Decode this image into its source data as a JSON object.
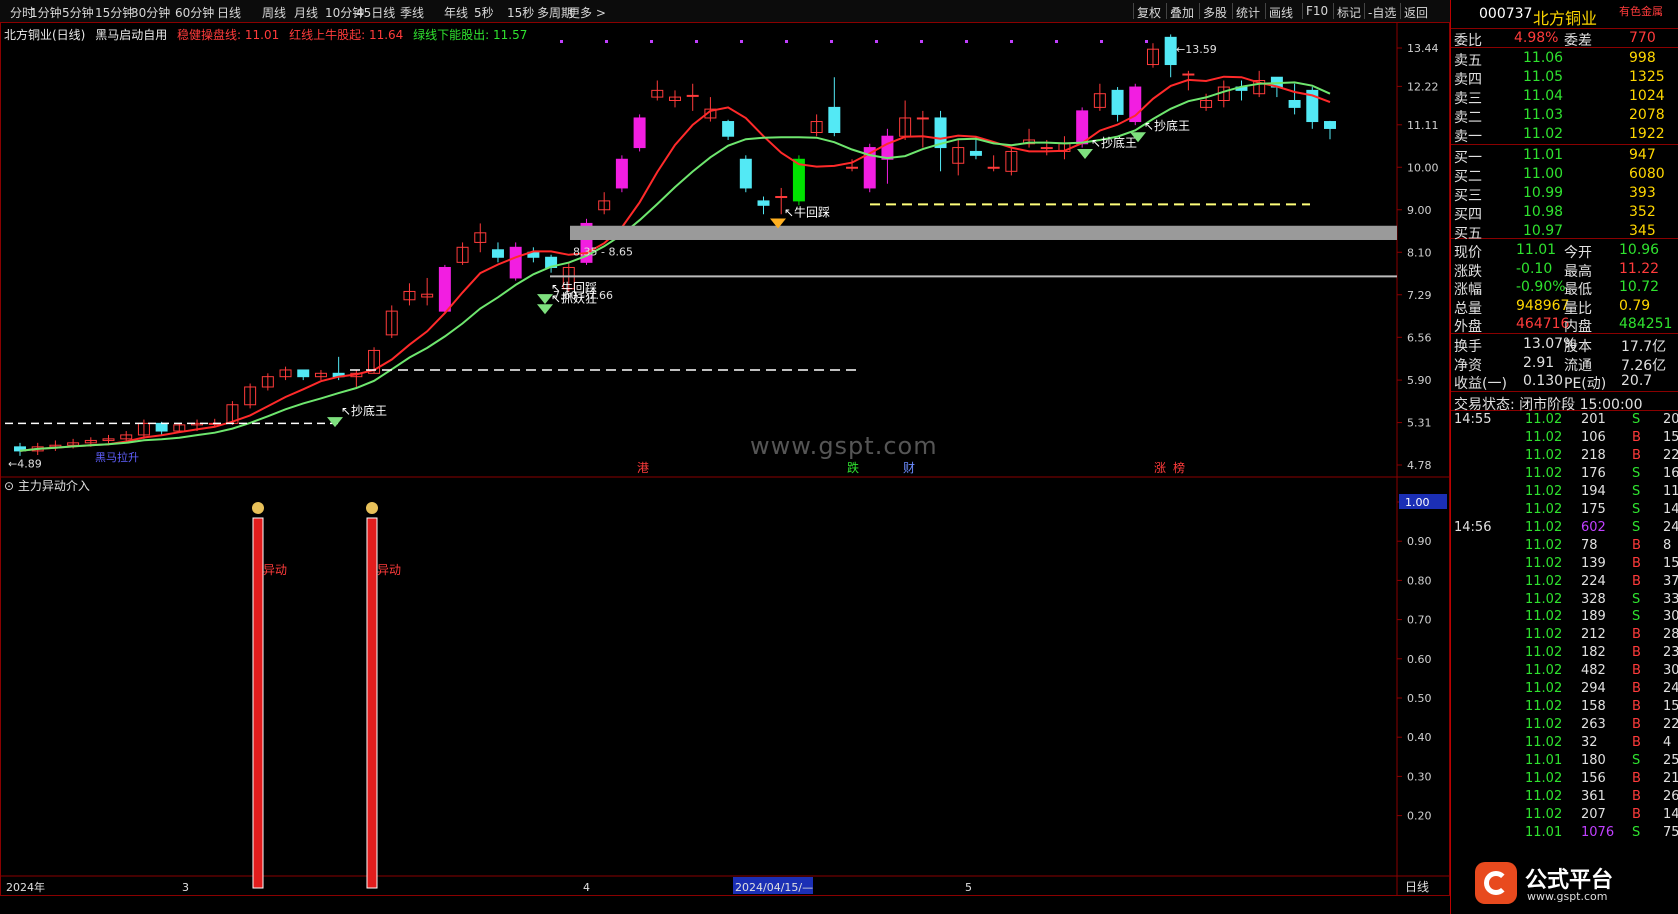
{
  "toolbar": {
    "periods": [
      "分时",
      "1分钟",
      "5分钟",
      "15分钟",
      "30分钟",
      "60分钟",
      "日线",
      "周线",
      "月线",
      "10分钟",
      "45日线",
      "季线",
      "年线",
      "5秒",
      "15秒",
      "多周期",
      "更多 >"
    ],
    "right_tools": [
      "复权",
      "叠加",
      "多股",
      "统计",
      "画线",
      "F10",
      "标记",
      "-自选",
      "返回"
    ]
  },
  "chart_header": {
    "stock_period": "北方铜业(日线)",
    "indicator_name": "黑马启动自用",
    "line1": "稳健操盘线: 11.01",
    "line2": "红线上牛股起: 11.64",
    "line3": "绿线下能股出: 11.57"
  },
  "price_axis": [
    "13.44",
    "12.22",
    "11.11",
    "10.00",
    "9.00",
    "8.10",
    "7.29",
    "6.56",
    "5.90",
    "5.31",
    "4.78"
  ],
  "chart_annotations": {
    "high_label": "13.59",
    "low_label": "4.89",
    "zone1": "8.35 - 8.65",
    "zone2": "7.60 - 7.66",
    "signals": [
      "抄底王",
      "牛回踩",
      "抄底王",
      "抄底王",
      "牛回踩",
      "抓妖狂"
    ],
    "bottom_label": "黑马拉升"
  },
  "watermark": "www.gspt.com",
  "event_markers": [
    "港",
    "跌",
    "财",
    "涨",
    "榜"
  ],
  "sub_chart": {
    "title": "主力异动介入",
    "axis": [
      "1.00",
      "0.90",
      "0.80",
      "0.70",
      "0.60",
      "0.50",
      "0.40",
      "0.30",
      "0.20"
    ],
    "bar_label": "异动"
  },
  "date_axis": [
    "2024年",
    "3",
    "4",
    "2024/04/15/—",
    "5"
  ],
  "period_label": "日线",
  "quote": {
    "code": "000737",
    "name": "北方铜业",
    "sector": "有色金属",
    "weibi_label": "委比",
    "weibi": "4.98%",
    "weicha_label": "委差",
    "weicha": "770",
    "sells": [
      {
        "label": "卖五",
        "price": "11.06",
        "vol": "998"
      },
      {
        "label": "卖四",
        "price": "11.05",
        "vol": "1325"
      },
      {
        "label": "卖三",
        "price": "11.04",
        "vol": "1024"
      },
      {
        "label": "卖二",
        "price": "11.03",
        "vol": "2078"
      },
      {
        "label": "卖一",
        "price": "11.02",
        "vol": "1922"
      }
    ],
    "buys": [
      {
        "label": "买一",
        "price": "11.01",
        "vol": "947"
      },
      {
        "label": "买二",
        "price": "11.00",
        "vol": "6080"
      },
      {
        "label": "买三",
        "price": "10.99",
        "vol": "393"
      },
      {
        "label": "买四",
        "price": "10.98",
        "vol": "352"
      },
      {
        "label": "买五",
        "price": "10.97",
        "vol": "345"
      }
    ],
    "stats": [
      {
        "l1": "现价",
        "v1": "11.01",
        "l2": "今开",
        "v2": "10.96"
      },
      {
        "l1": "涨跌",
        "v1": "-0.10",
        "l2": "最高",
        "v2": "11.22"
      },
      {
        "l1": "涨幅",
        "v1": "-0.90%",
        "l2": "最低",
        "v2": "10.72"
      },
      {
        "l1": "总量",
        "v1": "948967",
        "l2": "量比",
        "v2": "0.79"
      },
      {
        "l1": "外盘",
        "v1": "464716",
        "l2": "内盘",
        "v2": "484251"
      }
    ],
    "stats2": [
      {
        "l1": "换手",
        "v1": "13.07%",
        "l2": "股本",
        "v2": "17.7亿"
      },
      {
        "l1": "净资",
        "v1": "2.91",
        "l2": "流通",
        "v2": "7.26亿"
      },
      {
        "l1": "收益(一)",
        "v1": "0.130",
        "l2": "PE(动)",
        "v2": "20.7"
      }
    ],
    "trade_state": "交易状态: 闭市阶段 15:00:00"
  },
  "ticks": [
    {
      "t": "14:55",
      "p": "11.02",
      "v": "201",
      "s": "S",
      "n": "20"
    },
    {
      "t": "",
      "p": "11.02",
      "v": "106",
      "s": "B",
      "n": "15"
    },
    {
      "t": "",
      "p": "11.02",
      "v": "218",
      "s": "B",
      "n": "22"
    },
    {
      "t": "",
      "p": "11.02",
      "v": "176",
      "s": "S",
      "n": "16"
    },
    {
      "t": "",
      "p": "11.02",
      "v": "194",
      "s": "S",
      "n": "11"
    },
    {
      "t": "",
      "p": "11.02",
      "v": "175",
      "s": "S",
      "n": "14"
    },
    {
      "t": "14:56",
      "p": "11.02",
      "v": "602",
      "s": "S",
      "n": "24"
    },
    {
      "t": "",
      "p": "11.02",
      "v": "78",
      "s": "B",
      "n": "8"
    },
    {
      "t": "",
      "p": "11.02",
      "v": "139",
      "s": "B",
      "n": "15"
    },
    {
      "t": "",
      "p": "11.02",
      "v": "224",
      "s": "B",
      "n": "37"
    },
    {
      "t": "",
      "p": "11.02",
      "v": "328",
      "s": "S",
      "n": "33"
    },
    {
      "t": "",
      "p": "11.02",
      "v": "189",
      "s": "S",
      "n": "30"
    },
    {
      "t": "",
      "p": "11.02",
      "v": "212",
      "s": "B",
      "n": "28"
    },
    {
      "t": "",
      "p": "11.02",
      "v": "182",
      "s": "B",
      "n": "23"
    },
    {
      "t": "",
      "p": "11.02",
      "v": "482",
      "s": "B",
      "n": "30"
    },
    {
      "t": "",
      "p": "11.02",
      "v": "294",
      "s": "B",
      "n": "24"
    },
    {
      "t": "",
      "p": "11.02",
      "v": "158",
      "s": "B",
      "n": "15"
    },
    {
      "t": "",
      "p": "11.02",
      "v": "263",
      "s": "B",
      "n": "22"
    },
    {
      "t": "",
      "p": "11.02",
      "v": "32",
      "s": "B",
      "n": "4"
    },
    {
      "t": "",
      "p": "11.01",
      "v": "180",
      "s": "S",
      "n": "25"
    },
    {
      "t": "",
      "p": "11.02",
      "v": "156",
      "s": "B",
      "n": "21"
    },
    {
      "t": "",
      "p": "11.02",
      "v": "361",
      "s": "B",
      "n": "26"
    },
    {
      "t": "",
      "p": "11.02",
      "v": "207",
      "s": "B",
      "n": "14"
    },
    {
      "t": "",
      "p": "11.01",
      "v": "1076",
      "s": "S",
      "n": "75"
    }
  ],
  "logo": {
    "text": "公式平台",
    "url": "www.gspt.com"
  },
  "colors": {
    "up": "#ff3b3b",
    "down": "#2fe22f",
    "cyan": "#53e9f5",
    "magenta": "#f21ee1",
    "grid": "#8a0000"
  },
  "candles": [
    {
      "o": 5.0,
      "c": 4.95,
      "h": 5.05,
      "l": 4.89
    },
    {
      "o": 4.95,
      "c": 5.0,
      "h": 5.05,
      "l": 4.9
    },
    {
      "o": 5.0,
      "c": 5.02,
      "h": 5.08,
      "l": 4.95
    },
    {
      "o": 5.02,
      "c": 5.05,
      "h": 5.1,
      "l": 4.98
    },
    {
      "o": 5.05,
      "c": 5.08,
      "h": 5.12,
      "l": 5.0
    },
    {
      "o": 5.08,
      "c": 5.1,
      "h": 5.15,
      "l": 5.02
    },
    {
      "o": 5.1,
      "c": 5.15,
      "h": 5.2,
      "l": 5.05
    },
    {
      "o": 5.15,
      "c": 5.3,
      "h": 5.35,
      "l": 5.1
    },
    {
      "o": 5.3,
      "c": 5.2,
      "h": 5.32,
      "l": 5.15
    },
    {
      "o": 5.2,
      "c": 5.28,
      "h": 5.3,
      "l": 5.18
    },
    {
      "o": 5.28,
      "c": 5.3,
      "h": 5.35,
      "l": 5.2
    },
    {
      "o": 5.3,
      "c": 5.3,
      "h": 5.36,
      "l": 5.25
    },
    {
      "o": 5.3,
      "c": 5.55,
      "h": 5.6,
      "l": 5.28
    },
    {
      "o": 5.55,
      "c": 5.8,
      "h": 5.85,
      "l": 5.5
    },
    {
      "o": 5.8,
      "c": 5.95,
      "h": 6.0,
      "l": 5.75
    },
    {
      "o": 5.95,
      "c": 6.05,
      "h": 6.1,
      "l": 5.9
    },
    {
      "o": 6.05,
      "c": 5.95,
      "h": 6.05,
      "l": 5.9
    },
    {
      "o": 5.95,
      "c": 6.0,
      "h": 6.05,
      "l": 5.9
    },
    {
      "o": 6.0,
      "c": 5.95,
      "h": 6.25,
      "l": 5.9
    },
    {
      "o": 5.95,
      "c": 6.0,
      "h": 6.05,
      "l": 5.8
    },
    {
      "o": 6.0,
      "c": 6.35,
      "h": 6.4,
      "l": 6.0
    },
    {
      "o": 6.6,
      "c": 7.0,
      "h": 7.1,
      "l": 6.55
    },
    {
      "o": 7.2,
      "c": 7.35,
      "h": 7.5,
      "l": 7.1
    },
    {
      "o": 7.25,
      "c": 7.3,
      "h": 7.6,
      "l": 7.1
    },
    {
      "o": 7.0,
      "c": 7.8,
      "h": 7.85,
      "l": 6.95
    },
    {
      "o": 7.9,
      "c": 8.2,
      "h": 8.3,
      "l": 7.85
    },
    {
      "o": 8.3,
      "c": 8.5,
      "h": 8.7,
      "l": 8.1
    },
    {
      "o": 8.15,
      "c": 8.0,
      "h": 8.3,
      "l": 7.9
    },
    {
      "o": 7.6,
      "c": 8.2,
      "h": 8.3,
      "l": 7.55
    },
    {
      "o": 8.1,
      "c": 8.0,
      "h": 8.2,
      "l": 7.9
    },
    {
      "o": 8.0,
      "c": 7.8,
      "h": 8.05,
      "l": 7.7
    },
    {
      "o": 7.4,
      "c": 7.8,
      "h": 7.9,
      "l": 7.35
    },
    {
      "o": 7.9,
      "c": 8.7,
      "h": 8.8,
      "l": 7.85
    },
    {
      "o": 9.0,
      "c": 9.2,
      "h": 9.4,
      "l": 8.9
    },
    {
      "o": 9.5,
      "c": 10.2,
      "h": 10.3,
      "l": 9.4
    },
    {
      "o": 10.5,
      "c": 11.3,
      "h": 11.4,
      "l": 10.4
    },
    {
      "o": 11.9,
      "c": 12.1,
      "h": 12.4,
      "l": 11.8
    },
    {
      "o": 11.8,
      "c": 11.9,
      "h": 12.1,
      "l": 11.6
    },
    {
      "o": 11.95,
      "c": 11.95,
      "h": 12.3,
      "l": 11.5
    },
    {
      "o": 11.3,
      "c": 11.55,
      "h": 11.9,
      "l": 11.2
    },
    {
      "o": 11.2,
      "c": 10.8,
      "h": 11.25,
      "l": 10.7
    },
    {
      "o": 10.2,
      "c": 9.5,
      "h": 10.3,
      "l": 9.4
    },
    {
      "o": 9.2,
      "c": 9.1,
      "h": 9.3,
      "l": 8.9
    },
    {
      "o": 9.3,
      "c": 9.3,
      "h": 9.5,
      "l": 8.9
    },
    {
      "o": 9.2,
      "c": 10.2,
      "h": 10.3,
      "l": 9.1
    },
    {
      "o": 10.9,
      "c": 11.2,
      "h": 11.4,
      "l": 10.8
    },
    {
      "o": 11.6,
      "c": 10.9,
      "h": 12.5,
      "l": 10.8
    },
    {
      "o": 10.0,
      "c": 10.0,
      "h": 10.2,
      "l": 9.9
    },
    {
      "o": 9.5,
      "c": 10.5,
      "h": 10.6,
      "l": 9.4
    },
    {
      "o": 10.2,
      "c": 10.8,
      "h": 11.0,
      "l": 9.6
    },
    {
      "o": 10.8,
      "c": 11.3,
      "h": 11.8,
      "l": 10.7
    },
    {
      "o": 11.3,
      "c": 11.3,
      "h": 11.5,
      "l": 10.5
    },
    {
      "o": 11.3,
      "c": 10.5,
      "h": 11.5,
      "l": 9.9
    },
    {
      "o": 10.1,
      "c": 10.5,
      "h": 10.7,
      "l": 9.8
    },
    {
      "o": 10.4,
      "c": 10.3,
      "h": 10.8,
      "l": 10.2
    },
    {
      "o": 10.0,
      "c": 10.0,
      "h": 10.3,
      "l": 9.9
    },
    {
      "o": 9.9,
      "c": 10.4,
      "h": 10.5,
      "l": 9.8
    },
    {
      "o": 10.6,
      "c": 10.7,
      "h": 11.0,
      "l": 10.5
    },
    {
      "o": 10.5,
      "c": 10.5,
      "h": 10.7,
      "l": 10.3
    },
    {
      "o": 10.4,
      "c": 10.6,
      "h": 10.8,
      "l": 10.2
    },
    {
      "o": 10.6,
      "c": 11.5,
      "h": 11.6,
      "l": 10.5
    },
    {
      "o": 11.6,
      "c": 12.0,
      "h": 12.3,
      "l": 11.5
    },
    {
      "o": 12.1,
      "c": 11.4,
      "h": 12.2,
      "l": 11.2
    },
    {
      "o": 11.2,
      "c": 12.2,
      "h": 12.3,
      "l": 11.1
    },
    {
      "o": 12.9,
      "c": 13.4,
      "h": 13.6,
      "l": 12.8
    },
    {
      "o": 13.8,
      "c": 12.9,
      "h": 13.9,
      "l": 12.5
    },
    {
      "o": 12.6,
      "c": 12.6,
      "h": 12.7,
      "l": 12.1
    },
    {
      "o": 11.6,
      "c": 11.8,
      "h": 12.0,
      "l": 11.5
    },
    {
      "o": 11.8,
      "c": 12.2,
      "h": 12.4,
      "l": 11.6
    },
    {
      "o": 12.2,
      "c": 12.1,
      "h": 12.4,
      "l": 11.8
    },
    {
      "o": 12.0,
      "c": 12.4,
      "h": 12.7,
      "l": 11.9
    },
    {
      "o": 12.5,
      "c": 12.2,
      "h": 12.5,
      "l": 11.9
    },
    {
      "o": 11.8,
      "c": 11.6,
      "h": 12.3,
      "l": 11.4
    },
    {
      "o": 12.1,
      "c": 11.2,
      "h": 12.2,
      "l": 11.0
    },
    {
      "o": 11.2,
      "c": 11.01,
      "h": 11.22,
      "l": 10.72
    }
  ]
}
